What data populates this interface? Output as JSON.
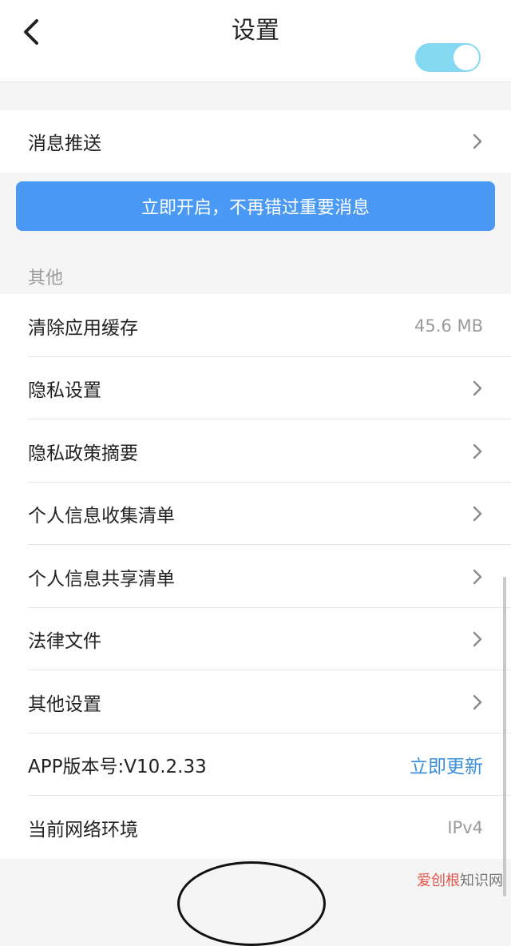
{
  "header": {
    "title": "设置"
  },
  "notification": {
    "label": "消息推送"
  },
  "cta": {
    "label": "立即开启，不再错过重要消息"
  },
  "section_other": {
    "title": "其他",
    "items": [
      {
        "label": "清除应用缓存",
        "value": "45.6 MB"
      },
      {
        "label": "隐私设置"
      },
      {
        "label": "隐私政策摘要"
      },
      {
        "label": "个人信息收集清单"
      },
      {
        "label": "个人信息共享清单"
      },
      {
        "label": "法律文件"
      },
      {
        "label": "其他设置"
      },
      {
        "label": "APP版本号:V10.2.33",
        "value": "立即更新"
      },
      {
        "label": "当前网络环境",
        "value": "IPv4"
      }
    ]
  },
  "watermark": {
    "part1": "爱创根",
    "part2": "知识网"
  },
  "colors": {
    "accent": "#4a9af5",
    "link": "#3a8fd8",
    "toggle": "#84d8f2"
  },
  "toggle_state": true
}
